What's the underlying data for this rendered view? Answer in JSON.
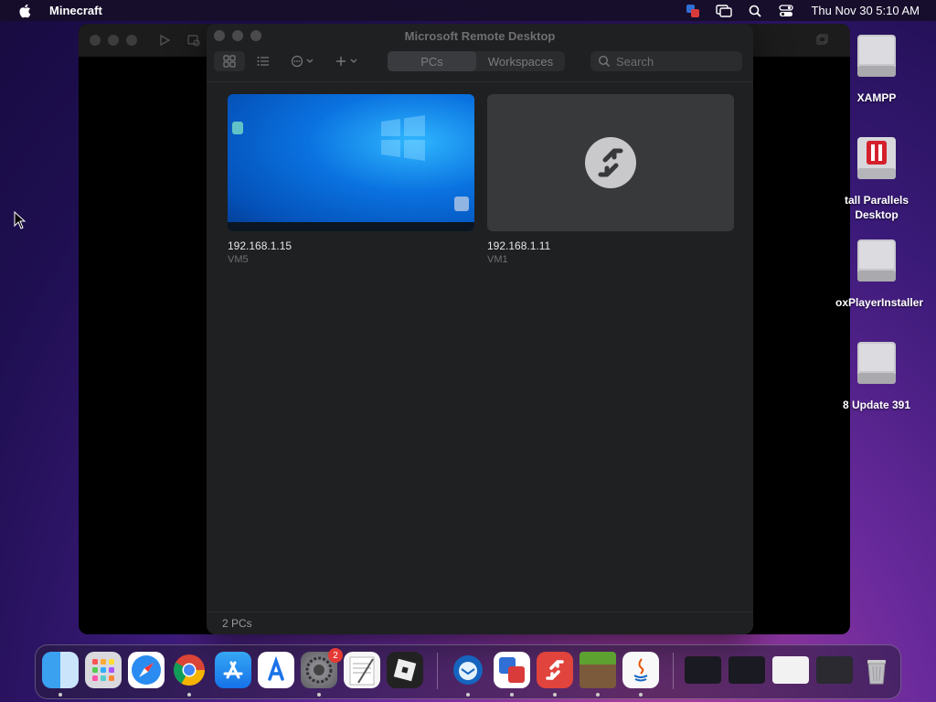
{
  "menubar": {
    "app_name": "Minecraft",
    "clock": "Thu Nov 30  5:10 AM"
  },
  "window": {
    "title": "Microsoft Remote Desktop",
    "tabs": [
      {
        "label": "PCs",
        "active": true
      },
      {
        "label": "Workspaces",
        "active": false
      }
    ],
    "search_placeholder": "Search",
    "pcs": [
      {
        "name": "192.168.1.15",
        "sub": "VM5",
        "thumbnail": "windows-desktop"
      },
      {
        "name": "192.168.1.11",
        "sub": "VM1",
        "thumbnail": "remote-desktop-placeholder"
      }
    ],
    "status": "2 PCs"
  },
  "desktop_icons": [
    {
      "label": "XAMPP",
      "icon": "drive-icon"
    },
    {
      "label": "tall Parallels Desktop",
      "icon": "parallels-installer-icon"
    },
    {
      "label": "oxPlayerInstaller",
      "icon": "drive-icon"
    },
    {
      "label": "8 Update 391",
      "icon": "drive-icon"
    }
  ],
  "dock": {
    "settings_badge": "2"
  },
  "colors": {
    "window_bg": "#1f2022",
    "accent_red": "#e53935"
  }
}
